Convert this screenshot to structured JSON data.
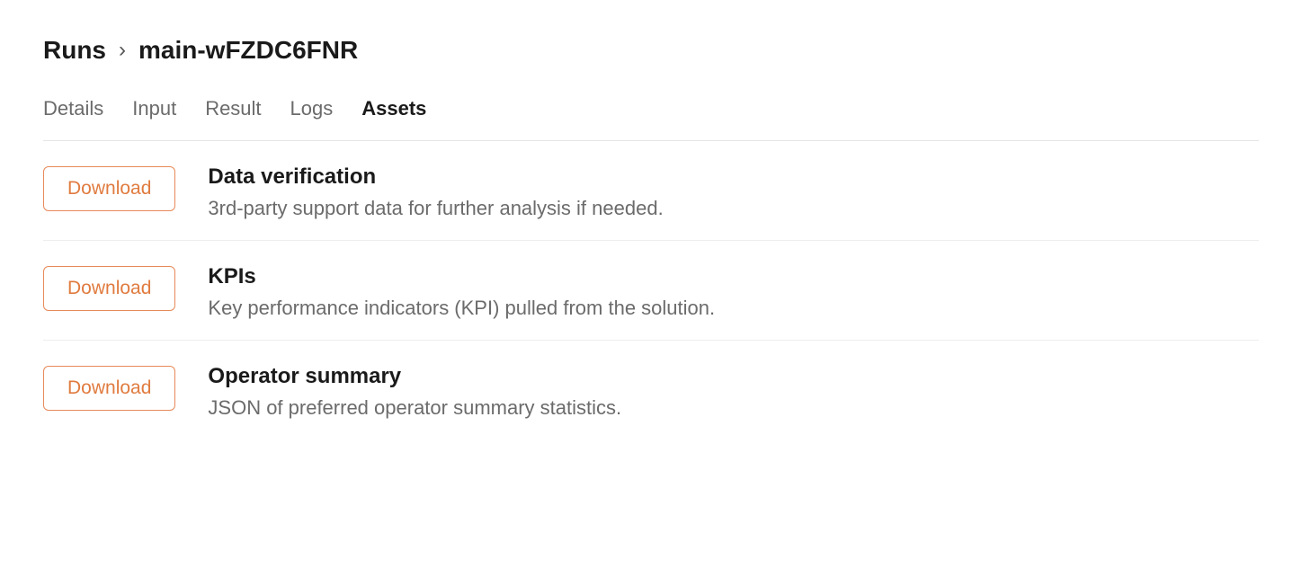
{
  "breadcrumb": {
    "root": "Runs",
    "separator": "›",
    "current": "main-wFZDC6FNR"
  },
  "tabs": [
    {
      "label": "Details",
      "active": false
    },
    {
      "label": "Input",
      "active": false
    },
    {
      "label": "Result",
      "active": false
    },
    {
      "label": "Logs",
      "active": false
    },
    {
      "label": "Assets",
      "active": true
    }
  ],
  "download_label": "Download",
  "assets": [
    {
      "title": "Data verification",
      "description": "3rd-party support data for further analysis if needed."
    },
    {
      "title": "KPIs",
      "description": "Key performance indicators (KPI) pulled from the solution."
    },
    {
      "title": "Operator summary",
      "description": "JSON of preferred operator summary statistics."
    }
  ]
}
